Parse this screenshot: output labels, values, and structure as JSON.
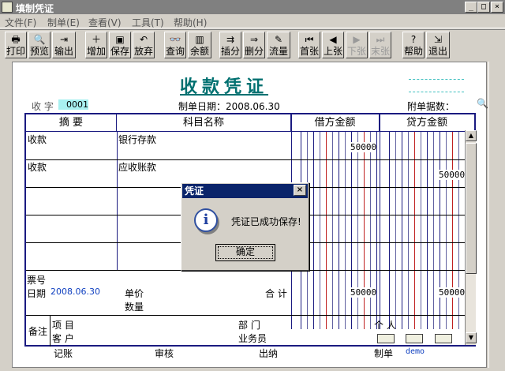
{
  "window": {
    "title": "填制凭证"
  },
  "menu": [
    "文件(F)",
    "制单(E)",
    "查看(V)",
    "工具(T)",
    "帮助(H)"
  ],
  "toolbar": [
    {
      "label": "打印",
      "icon": "printer-icon",
      "glyph": "🖶"
    },
    {
      "label": "预览",
      "icon": "preview-icon",
      "glyph": "🔍"
    },
    {
      "label": "输出",
      "icon": "export-icon",
      "glyph": "⇥"
    },
    {
      "label": "增加",
      "icon": "add-icon",
      "glyph": "＋"
    },
    {
      "label": "保存",
      "icon": "save-icon",
      "glyph": "▣"
    },
    {
      "label": "放弃",
      "icon": "undo-icon",
      "glyph": "↶"
    },
    {
      "label": "查询",
      "icon": "binoculars-icon",
      "glyph": "👓"
    },
    {
      "label": "余额",
      "icon": "bar-chart-icon",
      "glyph": "▥"
    },
    {
      "label": "插分",
      "icon": "insert-row-icon",
      "glyph": "⇉"
    },
    {
      "label": "删分",
      "icon": "delete-row-icon",
      "glyph": "⇒"
    },
    {
      "label": "流量",
      "icon": "pen-icon",
      "glyph": "✎"
    },
    {
      "label": "首张",
      "icon": "first-icon",
      "glyph": "⏮"
    },
    {
      "label": "上张",
      "icon": "prev-icon",
      "glyph": "◀"
    },
    {
      "label": "下张",
      "icon": "next-icon",
      "glyph": "▶"
    },
    {
      "label": "末张",
      "icon": "last-icon",
      "glyph": "⏭"
    },
    {
      "label": "帮助",
      "icon": "help-icon",
      "glyph": "?"
    },
    {
      "label": "退出",
      "icon": "exit-icon",
      "glyph": "⇲"
    }
  ],
  "voucher": {
    "title": "收款凭证",
    "type_label": "收 字",
    "number": "0001",
    "date_label": "制单日期：2008.06.30",
    "attach_label": "附单据数：",
    "headers": {
      "summary": "摘 要",
      "account": "科目名称",
      "debit": "借方金额",
      "credit": "贷方金额"
    },
    "rows": [
      {
        "summary": "收款",
        "account": "银行存款",
        "debit": "50000",
        "credit": ""
      },
      {
        "summary": "收款",
        "account": "应收账款",
        "debit": "",
        "credit": "50000"
      },
      {
        "summary": "",
        "account": "",
        "debit": "",
        "credit": ""
      },
      {
        "summary": "",
        "account": "",
        "debit": "",
        "credit": ""
      },
      {
        "summary": "",
        "account": "",
        "debit": "",
        "credit": ""
      }
    ],
    "ticket_label": "票号",
    "date_field_label": "日期",
    "date_value": "2008.06.30",
    "price_label": "单价",
    "qty_label": "数量",
    "total_label": "合 计",
    "total_debit": "50000",
    "total_credit": "50000",
    "remark_label": "备注",
    "project_label": "项 目",
    "dept_label": "部 门",
    "person_label": "个 人",
    "customer_label": "客 户",
    "salesman_label": "业务员",
    "footer": {
      "bookkeeping": "记账",
      "review": "审核",
      "cashier": "出纳",
      "maker_label": "制单",
      "maker": "demo"
    }
  },
  "dialog": {
    "title": "凭证",
    "message": "凭证已成功保存!",
    "ok": "确定"
  }
}
